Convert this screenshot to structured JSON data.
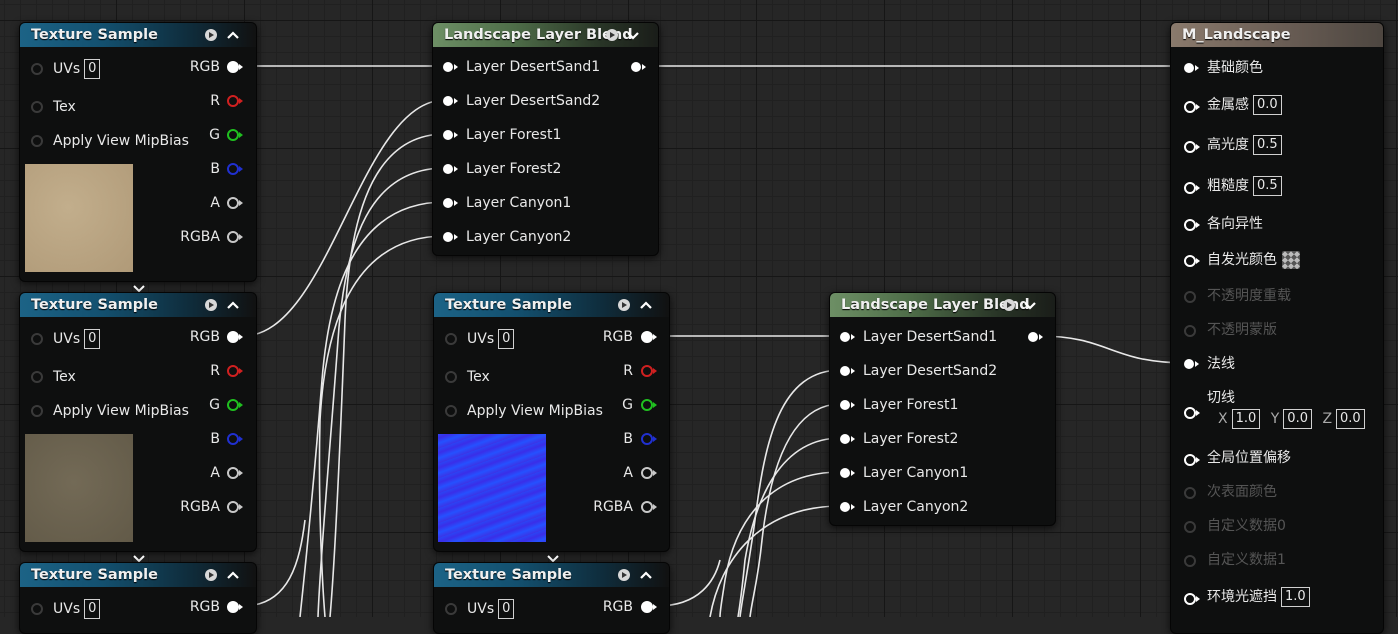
{
  "texture_sample": {
    "title": "Texture Sample",
    "inputs": [
      "UVs",
      "Tex",
      "Apply View MipBias"
    ],
    "uv_value": "0",
    "outputs": [
      "RGB",
      "R",
      "G",
      "B",
      "A",
      "RGBA"
    ],
    "output_colors": [
      "#ffffff",
      "#d02020",
      "#20c020",
      "#2030d0",
      "#c8c8c8",
      "#c8c8c8"
    ]
  },
  "layer_blend": {
    "title": "Landscape Layer Blend",
    "layers": [
      "Layer DesertSand1",
      "Layer DesertSand2",
      "Layer Forest1",
      "Layer Forest2",
      "Layer Canyon1",
      "Layer Canyon2"
    ]
  },
  "texture_colors": {
    "sand": "#b9a584",
    "brown": "#6b6350",
    "normal": "#2a3ef2"
  },
  "material": {
    "title": "M_Landscape",
    "pins": {
      "base_color": "基础颜色",
      "metallic": "金属感",
      "metallic_value": "0.0",
      "specular": "高光度",
      "specular_value": "0.5",
      "roughness": "粗糙度",
      "roughness_value": "0.5",
      "anisotropy": "各向异性",
      "emissive": "自发光颜色",
      "opacity": "不透明度重载",
      "opacity_mask": "不透明蒙版",
      "normal": "法线",
      "tangent": "切线",
      "tangent_x_label": "X",
      "tangent_x": "1.0",
      "tangent_y_label": "Y",
      "tangent_y": "0.0",
      "tangent_z_label": "Z",
      "tangent_z": "0.0",
      "wpo": "全局位置偏移",
      "subsurface": "次表面颜色",
      "custom0": "自定义数据0",
      "custom1": "自定义数据1",
      "ao": "环境光遮挡",
      "ao_value": "1.0"
    }
  }
}
